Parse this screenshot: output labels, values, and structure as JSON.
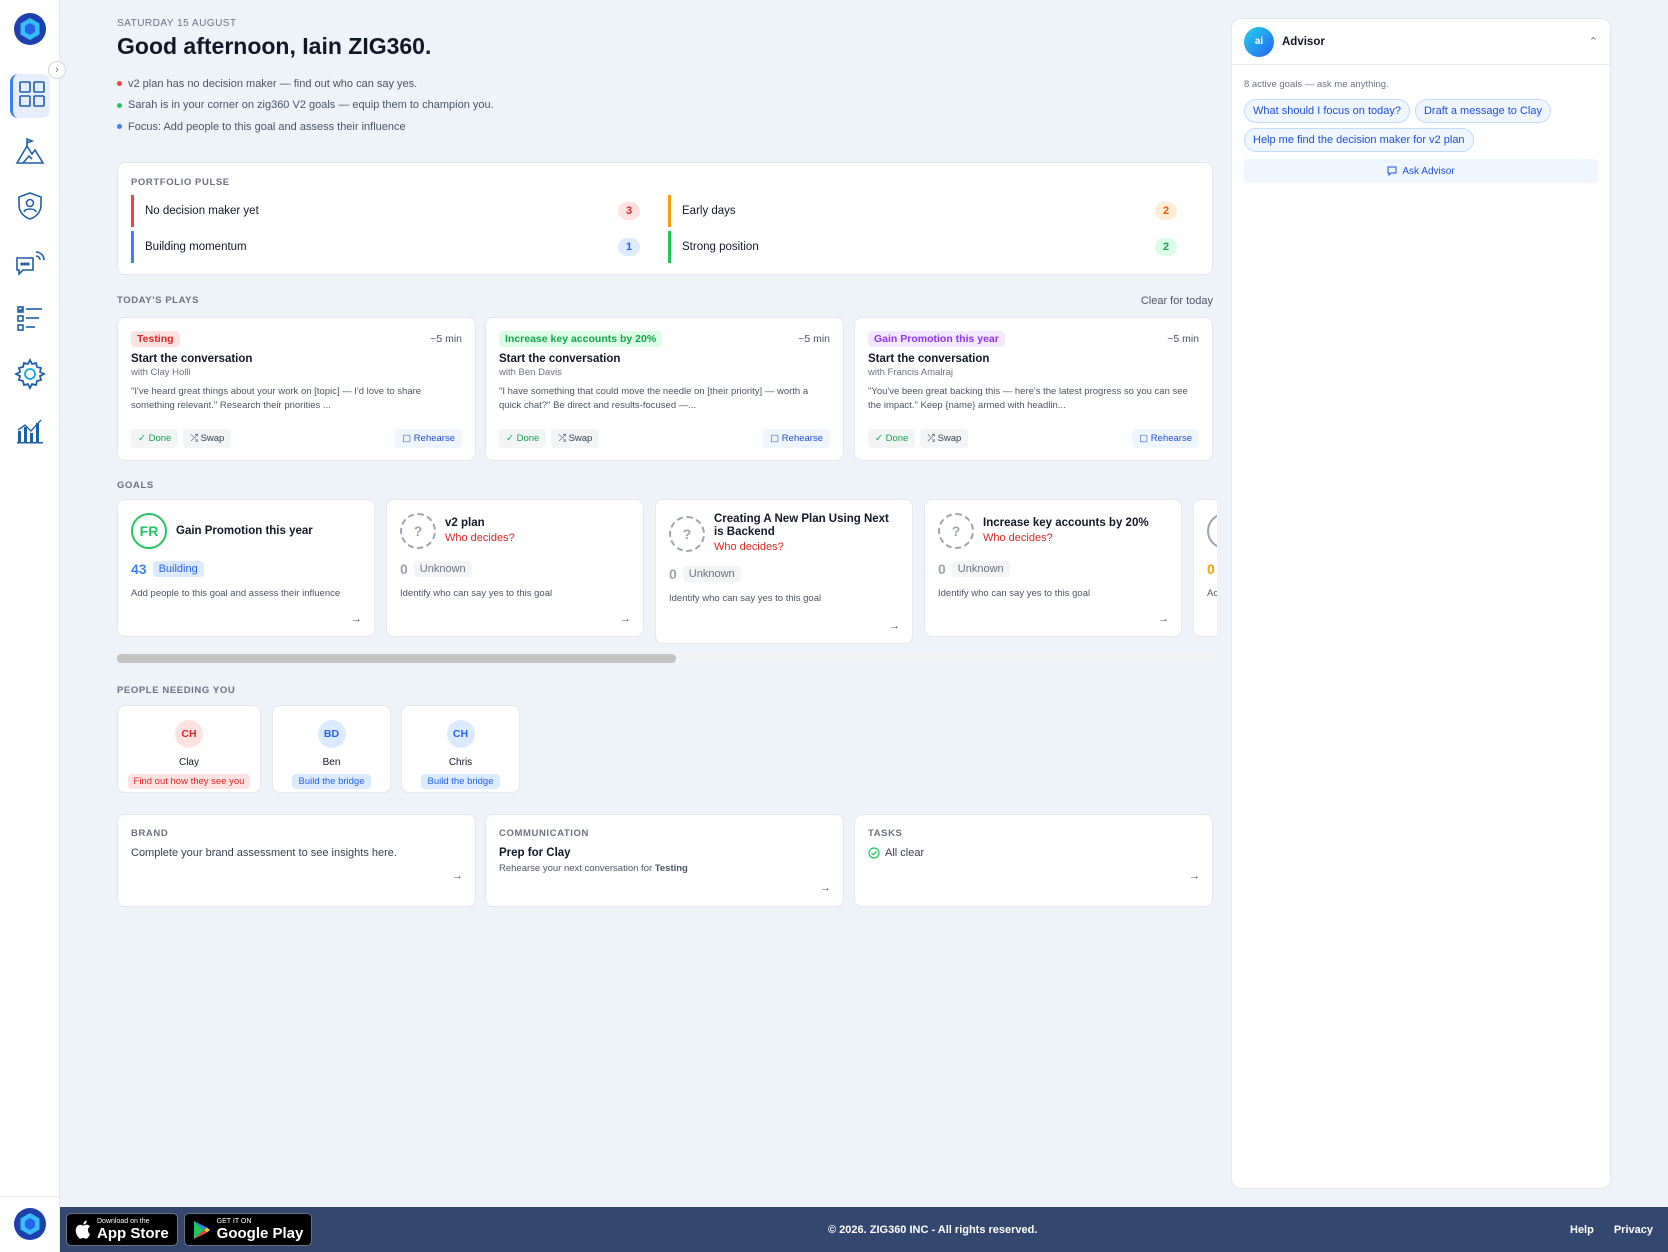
{
  "header": {
    "date": "SATURDAY 15 AUGUST",
    "greeting": "Good afternoon, Iain ZIG360.",
    "insights": [
      {
        "text": "v2 plan has no decision maker — find out who can say yes.",
        "color": "#ef4444"
      },
      {
        "text": "Sarah is in your corner on zig360 V2 goals — equip them to champion you.",
        "color": "#22c55e"
      },
      {
        "text": "Focus: Add people to this goal and assess their influence",
        "color": "#3b82f6"
      }
    ]
  },
  "pulse": {
    "title": "PORTFOLIO PULSE",
    "items": [
      {
        "label": "No decision maker yet",
        "count": "3",
        "color": "#ef4444"
      },
      {
        "label": "Early days",
        "count": "2",
        "color": "#f59e0b"
      },
      {
        "label": "Building momentum",
        "count": "1",
        "color": "#3b82f6"
      },
      {
        "label": "Strong position",
        "count": "2",
        "color": "#22c55e"
      }
    ]
  },
  "plays": {
    "title": "TODAY'S PLAYS",
    "clear": "Clear for today",
    "items": [
      {
        "tag": "Testing",
        "time": "~5 min",
        "title": "Start the conversation",
        "with": "with Clay Holli",
        "quote": "\"I've heard great things about your work on [topic] — I'd love to share something relevant.\" Research their priorities ...",
        "done": "Done",
        "swap": "Swap",
        "rehearse": "Rehearse"
      },
      {
        "tag": "Increase key accounts by 20%",
        "time": "~5 min",
        "title": "Start the conversation",
        "with": "with Ben Davis",
        "quote": "\"I have something that could move the needle on [their priority] — worth a quick chat?\" Be direct and results-focused —...",
        "done": "Done",
        "swap": "Swap",
        "rehearse": "Rehearse"
      },
      {
        "tag": "Gain Promotion this year",
        "time": "~5 min",
        "title": "Start the conversation",
        "with": "with Francis Amalraj",
        "quote": "\"You've been great backing this — here's the latest progress so you can see the impact.\" Keep {name} armed with headlin...",
        "done": "Done",
        "swap": "Swap",
        "rehearse": "Rehearse"
      }
    ]
  },
  "goals": {
    "title": "GOALS",
    "items": [
      {
        "avatar": "FR",
        "name": "Gain Promotion this year",
        "who": "",
        "score": "43",
        "status": "Building",
        "desc": "Add people to this goal and assess their influence"
      },
      {
        "avatar": "?",
        "name": "v2 plan",
        "who": "Who decides?",
        "score": "0",
        "status": "Unknown",
        "desc": "Identify who can say yes to this goal"
      },
      {
        "avatar": "?",
        "name": "Creating A New Plan Using Next is Backend",
        "who": "Who decides?",
        "score": "0",
        "status": "Unknown",
        "desc": "Identify who can say yes to this goal"
      },
      {
        "avatar": "?",
        "name": "Increase key accounts by 20%",
        "who": "Who decides?",
        "score": "0",
        "status": "Unknown",
        "desc": "Identify who can say yes to this goal"
      },
      {
        "avatar": "",
        "name": "",
        "who": "",
        "score": "0",
        "status": "",
        "desc": "Ac"
      }
    ]
  },
  "people": {
    "title": "PEOPLE NEEDING YOU",
    "items": [
      {
        "initials": "CH",
        "name": "Clay",
        "action": "Find out how they see you"
      },
      {
        "initials": "BD",
        "name": "Ben",
        "action": "Build the bridge"
      },
      {
        "initials": "CH",
        "name": "Chris",
        "action": "Build the bridge"
      }
    ]
  },
  "brand": {
    "title": "BRAND",
    "text": "Complete your brand assessment to see insights here."
  },
  "communication": {
    "title": "COMMUNICATION",
    "heading": "Prep for Clay",
    "sub": "Rehearse your next conversation for",
    "sub_strong": "Testing"
  },
  "tasks": {
    "title": "TASKS",
    "text": "All clear"
  },
  "advisor": {
    "title": "Advisor",
    "hint": "8 active goals — ask me anything.",
    "chips": [
      "What should I focus on today?",
      "Draft a message to Clay",
      "Help me find the decision maker for v2 plan"
    ],
    "ask": "Ask Advisor"
  },
  "footer": {
    "appstore_small": "Download on the",
    "appstore_big": "App Store",
    "play_small": "GET IT ON",
    "play_big": "Google Play",
    "copyright": "© 2026. ZIG360 INC - All rights reserved.",
    "help": "Help",
    "privacy": "Privacy"
  }
}
